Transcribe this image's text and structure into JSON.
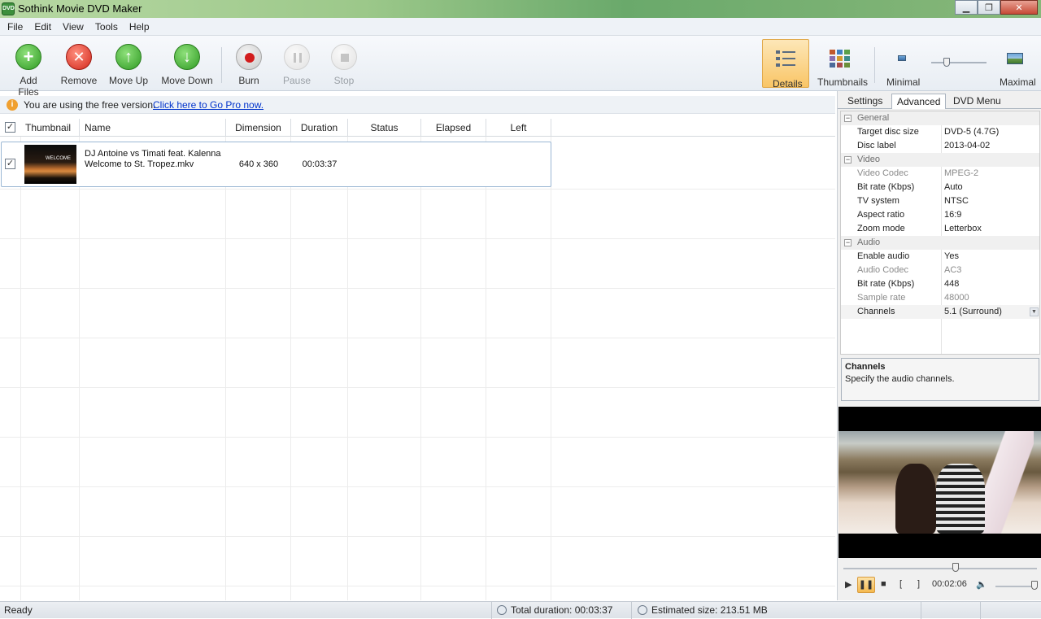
{
  "window": {
    "title": "Sothink Movie DVD Maker",
    "icon_text": "DVD",
    "minimize": "▁",
    "maximize": "❐",
    "close": "✕"
  },
  "menu": [
    "File",
    "Edit",
    "View",
    "Tools",
    "Help"
  ],
  "toolbar": {
    "add_files": "Add Files",
    "remove": "Remove",
    "move_up": "Move Up",
    "move_down": "Move Down",
    "burn": "Burn",
    "pause": "Pause",
    "stop": "Stop",
    "details": "Details",
    "thumbnails": "Thumbnails",
    "minimal": "Minimal",
    "maximal": "Maximal"
  },
  "info": {
    "message": "You are using the free version.",
    "link": "Click here to Go Pro now."
  },
  "grid": {
    "columns": [
      "Thumbnail",
      "Name",
      "Dimension",
      "Duration",
      "Status",
      "Elapsed",
      "Left"
    ],
    "rows": [
      {
        "checked": true,
        "thumb_text": "WELCOME",
        "name": "DJ Antoine vs Timati feat. Kalenna  Welcome to St. Tropez.mkv",
        "dimension": "640 x 360",
        "duration": "00:03:37",
        "status": "",
        "elapsed": "",
        "left": ""
      }
    ]
  },
  "tabs": [
    "Settings",
    "Advanced",
    "DVD Menu"
  ],
  "properties": {
    "general": {
      "label": "General",
      "rows": [
        {
          "key": "Target disc size",
          "value": "DVD-5 (4.7G)"
        },
        {
          "key": "Disc label",
          "value": "2013-04-02"
        }
      ]
    },
    "video": {
      "label": "Video",
      "rows": [
        {
          "key": "Video Codec",
          "value": "MPEG-2",
          "disabled": true
        },
        {
          "key": "Bit rate (Kbps)",
          "value": "Auto"
        },
        {
          "key": "TV system",
          "value": "NTSC"
        },
        {
          "key": "Aspect ratio",
          "value": "16:9"
        },
        {
          "key": "Zoom mode",
          "value": "Letterbox"
        }
      ]
    },
    "audio": {
      "label": "Audio",
      "rows": [
        {
          "key": "Enable audio",
          "value": "Yes"
        },
        {
          "key": "Audio Codec",
          "value": "AC3",
          "disabled": true
        },
        {
          "key": "Bit rate (Kbps)",
          "value": "448"
        },
        {
          "key": "Sample rate",
          "value": "48000",
          "disabled": true
        },
        {
          "key": "Channels",
          "value": "5.1 (Surround)"
        }
      ]
    }
  },
  "description": {
    "title": "Channels",
    "text": "Specify the audio channels."
  },
  "player": {
    "time": "00:02:06",
    "play": "▶",
    "pause": "❚❚",
    "stop": "■",
    "mark_in": "[",
    "mark_out": "]",
    "volume": "🔈"
  },
  "status": {
    "ready": "Ready",
    "total_duration": "Total duration: 00:03:37",
    "estimated_size": "Estimated size: 213.51 MB"
  },
  "colors": {
    "accent_details": "#f9c566",
    "link": "#0033cc",
    "selection_border": "#9bb7d4"
  }
}
